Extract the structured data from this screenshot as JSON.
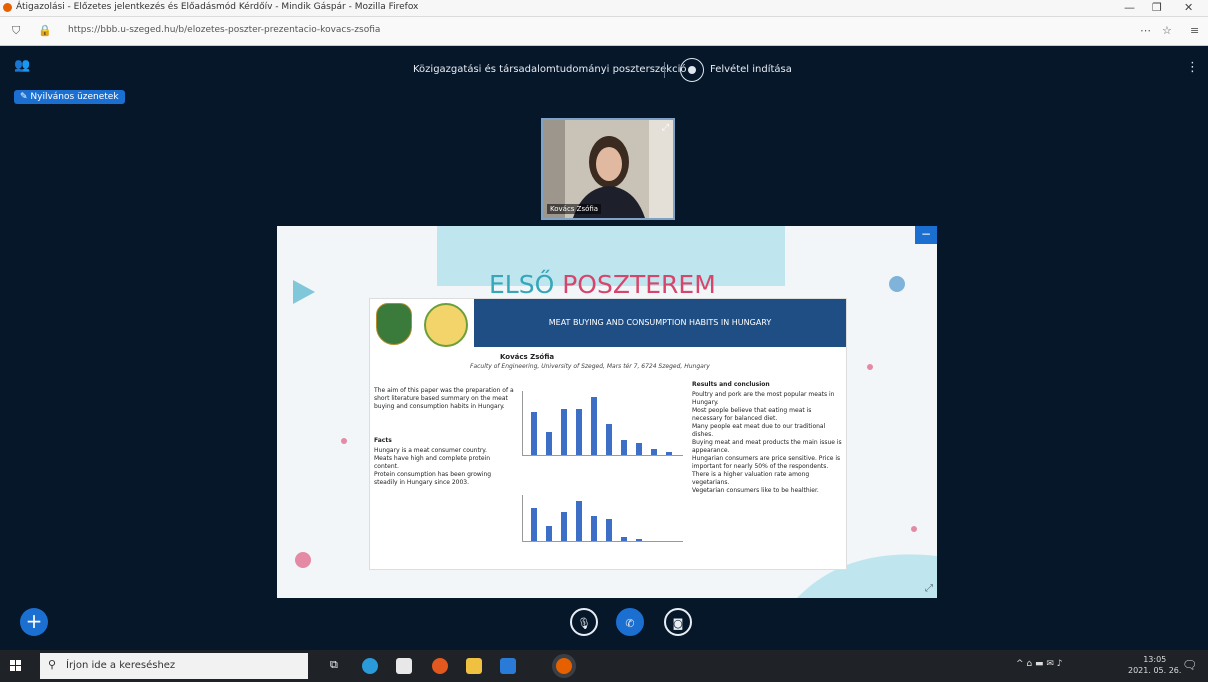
{
  "browser": {
    "tab_title": "Átigazolási - Előzetes jelentkezés és Előadásmód Kérdőív - Mindik Gáspár - Mozilla Firefox",
    "url": "https://bbb.u-szeged.hu/b/elozetes-poszter-prezentacio-kovacs-zsofia",
    "min_label": "—",
    "max_label": "❐",
    "close_label": "✕"
  },
  "meeting": {
    "title": "Közigazgatási és társadalomtudományi poszterszekció",
    "recording_label": "Felvétel indítása",
    "public_chat_label": "Nyilvános üzenetek"
  },
  "webcam": {
    "name": "Kovács Zsófia"
  },
  "slide": {
    "title_part1": "ELSŐ",
    "title_part2": "POSZTEREM",
    "poster_header": "MEAT BUYING AND CONSUMPTION HABITS IN HUNGARY",
    "author": "Kovács Zsófia",
    "affiliation": "Faculty of Engineering, University of Szeged, Mars tér 7, 6724 Szeged, Hungary",
    "intro": "The aim of this paper was the preparation of a short literature based summary on the meat buying and consumption habits in Hungary.",
    "facts_heading": "Facts",
    "facts": [
      "Hungary is a meat consumer country.",
      "Meats have high and complete protein content.",
      "Protein consumption has been growing steadily in Hungary since 2003."
    ],
    "results_heading": "Results and conclusion",
    "results": [
      "Poultry and pork are the most popular meats in Hungary.",
      "Most people believe that eating meat is necessary for balanced diet.",
      "Many people eat meat due to our traditional dishes.",
      "Buying meat and meat products the main issue is appearance.",
      "Hungarian consumers are price sensitive. Price is important for nearly 50% of the respondents.",
      "There is a higher valuation rate among vegetarians.",
      "Vegetarian consumers like to be healthier."
    ],
    "chart1_values": [
      55,
      30,
      60,
      60,
      75,
      40,
      20,
      15,
      8,
      4
    ],
    "chart2_values": [
      45,
      20,
      40,
      55,
      35,
      30,
      5,
      3
    ]
  },
  "taskbar": {
    "search_placeholder": "Írjon ide a kereséshez",
    "tray_text": "^ ⌂ ▬ ✉ ♪",
    "time": "13:05",
    "date": "2021. 05. 26."
  }
}
